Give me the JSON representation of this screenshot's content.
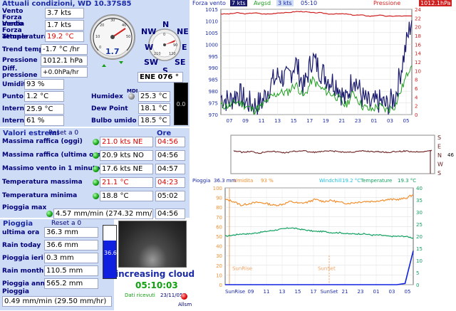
{
  "title": "Attuali condizioni, WD 10.37S85",
  "current": {
    "vento_label": "Vento Forza media",
    "vento_value": "3.7 kts",
    "vento_attuale_label": "Vento Forza attuale",
    "vento_attuale_value": "1.7 kts",
    "temperatura_label": "Temperatura",
    "temperatura_value": "19.2 °C",
    "trend_label": "Trend temp",
    "trend_value": "-1.7 °C /hr",
    "pressione_label": "Pressione",
    "pressione_value": "1012.1 hPa",
    "diff_label": "Diff. pressione",
    "diff_value": "+0.0hPa/hr",
    "umidita_label": "Umidita",
    "umidita_value": "93 %",
    "punto_label": "Punto dep.",
    "punto_value": "1.2 °C",
    "interna_temp_label": "Interna temp.",
    "interna_temp_value": "25.9 °C",
    "interna_hum_label": "Interna hum",
    "interna_hum_value": "61 %",
    "humidex_label": "Humidex",
    "humidex_value": "25.3 °C",
    "dewpoint_label": "Dew Point",
    "dewpoint_value": "18.1 °C",
    "bulbo_label": "Bulbo umido",
    "bulbo_value": "18.5 °C",
    "mdi_label": "MDI",
    "side_value": "0.0"
  },
  "gauge": {
    "speed_value": "1.7",
    "compass_value": "ENE  076 °",
    "ticks": [
      "0",
      "10",
      "20",
      "30",
      "40",
      "50"
    ],
    "compass_ticks": [
      "0",
      "90",
      "120",
      "150",
      "210",
      "30"
    ],
    "dirs": {
      "n": "N",
      "ne": "NE",
      "e": "E",
      "se": "SE",
      "s": "S",
      "sw": "SW",
      "w": "W",
      "nw": "NW"
    }
  },
  "extremes": {
    "title": "Valori estremi",
    "reset": "Reset a 0",
    "ore_label": "Ore",
    "rows": [
      {
        "label": "Massima raffica (oggi)",
        "value": "21.0 kts  NE",
        "time": "04:56",
        "red": true
      },
      {
        "label": "Massima raffica (ultima ora)",
        "value": "20.9 kts  NO",
        "time": "04:56",
        "red": false
      },
      {
        "label": "Massimo vento in 1 minuto",
        "value": "17.6 kts  NE",
        "time": "04:57",
        "red": false
      },
      {
        "label": "Temperatura massima",
        "value": "21.1 °C",
        "time": "04:23",
        "red": true
      },
      {
        "label": "Temperatura minima",
        "value": "18.8 °C",
        "time": "05:02",
        "red": false
      },
      {
        "label": "Pioggia max",
        "value": "4.57 mm/min (274.32 mm/h)",
        "time": "04:56",
        "red": false
      }
    ]
  },
  "rain": {
    "title": "Pioggia",
    "reset": "Reset a 0",
    "gauge_value": "36.6",
    "rows": [
      {
        "label": "ultima ora",
        "value": "36.3 mm"
      },
      {
        "label": "Rain today",
        "value": "36.6 mm"
      },
      {
        "label": "Pioggia ieri",
        "value": "0.3 mm"
      },
      {
        "label": "Rain month",
        "value": "110.5 mm"
      },
      {
        "label": "Pioggia anno",
        "value": "565.2 mm"
      }
    ],
    "rate_label": "Pioggia",
    "rate_value": "0.49 mm/min (29.50 mm/hr)"
  },
  "status": {
    "forecast": "increasing cloud",
    "time": "05:10:03",
    "dati_label": "Dati ricevuti",
    "date": "23/11/057",
    "allarm": "Allsm"
  },
  "chart_top_legend": {
    "forza_label": "Forza vento",
    "forza_value": "7 kts",
    "avg_label": "Avgsd",
    "avg_value": "3 kts",
    "time": "05:10",
    "press_label": "Pressione",
    "press_value": "1012.1hPa"
  },
  "chart_bottom_legend": {
    "pioggia_label": "Pioggia",
    "pioggia_value": "36.3 mm",
    "umid_label": "Umidita",
    "umid_value": "93 %",
    "windchill_label": "Windchill",
    "windchill_value": "19.2 °C",
    "temp_label": "Temperature",
    "temp_value": "19.3 °C",
    "sunrise": "SunRise",
    "sunset": "SunSet",
    "dir_value": "46"
  },
  "colors": {
    "panel": "#cfdcf5",
    "header": "#1a2aa8",
    "wind": "#1a1a6e",
    "wind_avg": "#20a020",
    "pressure": "#d02020",
    "humidity": "#f09030",
    "temp": "#10a060",
    "rain": "#1020e0",
    "direction": "#6a2020"
  },
  "chart_data": [
    {
      "type": "line",
      "xlabel": "",
      "ylabel": "",
      "x_ticks": [
        "07",
        "09",
        "11",
        "13",
        "15",
        "17",
        "19",
        "21",
        "23",
        "01",
        "03",
        "05"
      ],
      "y_left_ticks": [
        970,
        975,
        980,
        985,
        990,
        995,
        1000,
        1005,
        1010,
        1015
      ],
      "y_right_ticks": [
        0,
        2,
        4,
        6,
        8,
        10,
        12,
        14,
        16,
        18,
        20,
        22,
        24
      ],
      "ylim_left": [
        970,
        1015
      ],
      "ylim_right": [
        0,
        24
      ],
      "series": [
        {
          "name": "Pressione",
          "axis": "left",
          "values": [
            1013,
            1013,
            1013.5,
            1013,
            1013.5,
            1013,
            1013,
            1013.5,
            1013.5,
            1014,
            1014,
            1013.5,
            1013.5,
            1013,
            1013,
            1013,
            1012.5,
            1012.5,
            1012,
            1012.5,
            1012,
            1012.1,
            1012.1,
            1012.1
          ]
        },
        {
          "name": "Forza vento",
          "axis": "right",
          "values": [
            4,
            3,
            5,
            3,
            2,
            3,
            7,
            9,
            8,
            12,
            6,
            13,
            10,
            8,
            7,
            3,
            9,
            4,
            2,
            3,
            2,
            4,
            13,
            22
          ]
        },
        {
          "name": "Avgsd",
          "axis": "right",
          "values": [
            2,
            2,
            3,
            2,
            1,
            2,
            4,
            5,
            5,
            7,
            4,
            8,
            6,
            5,
            4,
            2,
            5,
            2,
            1,
            2,
            1,
            2,
            7,
            12
          ]
        }
      ]
    },
    {
      "type": "line",
      "xlabel": "",
      "ylabel": "",
      "y_right_ticks": [
        "S",
        "E",
        "N",
        "W",
        "S"
      ],
      "series": [
        {
          "name": "Direzione",
          "values": [
            46,
            50,
            48,
            52,
            47,
            49,
            51,
            48,
            46,
            50,
            49,
            47,
            48,
            50,
            49,
            47,
            48,
            49,
            50,
            48,
            47,
            49,
            48,
            46
          ]
        }
      ]
    },
    {
      "type": "line",
      "xlabel": "",
      "ylabel": "",
      "x_ticks": [
        "SunRise",
        "09",
        "11",
        "13",
        "15",
        "17",
        "SunSet",
        "21",
        "23",
        "01",
        "03",
        "05"
      ],
      "y_left_ticks": [
        0,
        10,
        20,
        30,
        40,
        50,
        60,
        70,
        80,
        90,
        100
      ],
      "y_right_ticks": [
        0,
        5,
        10,
        15,
        20,
        25,
        30,
        35,
        40
      ],
      "ylim_left": [
        0,
        100
      ],
      "ylim_right": [
        0,
        40
      ],
      "series": [
        {
          "name": "Umidita",
          "axis": "left",
          "values": [
            88,
            86,
            82,
            84,
            85,
            84,
            82,
            83,
            86,
            84,
            85,
            88,
            86,
            87,
            85,
            84,
            85,
            86,
            86,
            87,
            88,
            88,
            89,
            93
          ]
        },
        {
          "name": "Temperature",
          "axis": "right",
          "values": [
            20,
            20.5,
            21,
            21,
            21.5,
            22,
            22.5,
            23,
            23.5,
            23,
            22.5,
            22,
            22,
            21.5,
            21.5,
            21,
            21,
            21,
            20.5,
            20.5,
            20,
            20,
            20,
            19.3
          ]
        },
        {
          "name": "Pioggia",
          "axis": "right",
          "values": [
            0,
            0,
            0,
            0,
            0,
            0,
            0,
            0,
            0,
            0,
            0,
            0,
            0,
            0,
            0,
            0,
            0,
            0,
            0,
            0,
            0,
            0,
            0.5,
            14
          ]
        }
      ]
    }
  ]
}
